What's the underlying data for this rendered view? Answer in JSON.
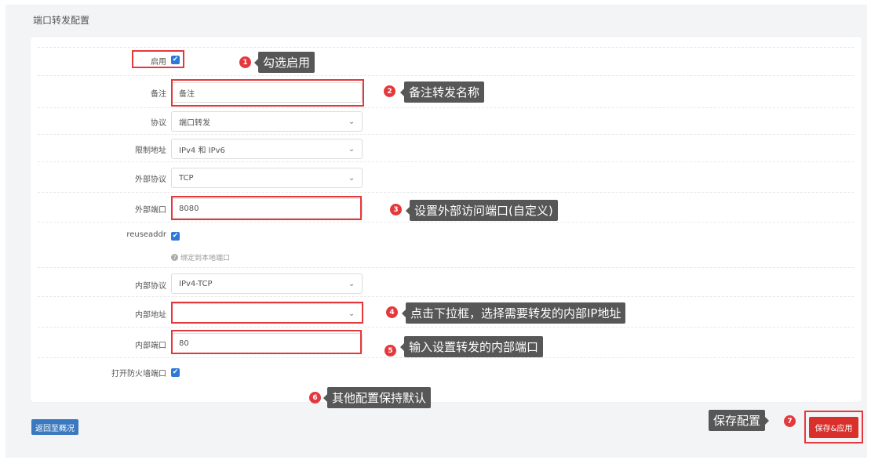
{
  "page": {
    "title": "端口转发配置"
  },
  "form": {
    "enable_label": "启用",
    "note_label": "备注",
    "note_value": "备注",
    "protocol_label": "协议",
    "protocol_value": "端口转发",
    "restrict_label": "限制地址",
    "restrict_value": "IPv4 和 IPv6",
    "ext_proto_label": "外部协议",
    "ext_proto_value": "TCP",
    "ext_port_label": "外部端口",
    "ext_port_value": "8080",
    "reuse_label": "reuseaddr",
    "reuse_hint": "绑定到本地端口",
    "int_proto_label": "内部协议",
    "int_proto_value": "IPv4-TCP",
    "int_addr_label": "内部地址",
    "int_addr_value": "",
    "int_port_label": "内部端口",
    "int_port_value": "80",
    "firewall_label": "打开防火墙端口"
  },
  "annotations": {
    "a1": {
      "num": "1",
      "text": "勾选启用"
    },
    "a2": {
      "num": "2",
      "text": "备注转发名称"
    },
    "a3": {
      "num": "3",
      "text": "设置外部访问端口(自定义)"
    },
    "a4": {
      "num": "4",
      "text": "点击下拉框，选择需要转发的内部IP地址"
    },
    "a5": {
      "num": "5",
      "text": "输入设置转发的内部端口"
    },
    "a6": {
      "num": "6",
      "text": "其他配置保持默认"
    },
    "a7": {
      "num": "7",
      "text": "保存配置"
    }
  },
  "buttons": {
    "back": "返回至概况",
    "save_apply": "保存&应用"
  },
  "colors": {
    "accent": "#2f78d6",
    "annotation_red": "#e4393c",
    "callout_bg": "#575757",
    "save_button": "#d9302c",
    "back_button": "#3a78c0"
  },
  "icons": {
    "checkbox": "check-icon",
    "select": "chevron-down-icon",
    "hint": "info-icon"
  }
}
